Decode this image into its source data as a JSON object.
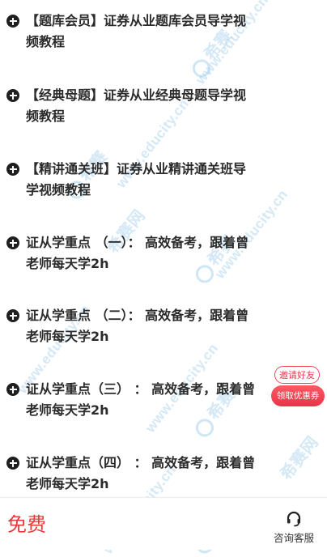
{
  "watermark": {
    "domain": "www.educity.cn",
    "brand": "希赛网",
    "brand_short": "希赛"
  },
  "items": [
    {
      "line1": "【题库会员】证券从业题库会员导学视",
      "line2": "频教程"
    },
    {
      "line1": "【经典母题】证券从业经典母题导学视",
      "line2": "频教程"
    },
    {
      "line1": "【精讲通关班】证券从业精讲通关班导",
      "line2": "学视频教程"
    },
    {
      "line1": "证从学重点 （一）： 高效备考，跟着曾",
      "line2": "老师每天学2h"
    },
    {
      "line1": "证从学重点 （二）： 高效备考，跟着曾",
      "line2": "老师每天学2h"
    },
    {
      "line1": "证从学重点（三） ： 高效备考，跟着曾",
      "line2": "老师每天学2h"
    },
    {
      "line1": "证从学重点（四） ： 高效备考，跟着曾",
      "line2": "老师每天学2h"
    }
  ],
  "invite": {
    "top_label": "邀请好友",
    "bottom_label": "领取优惠券"
  },
  "bottom_bar": {
    "free_label": "免费",
    "service_label": "咨询客服"
  },
  "colors": {
    "accent_red": "#e83b3b",
    "text": "#2b2b2b",
    "watermark": "#a0cdeb"
  }
}
